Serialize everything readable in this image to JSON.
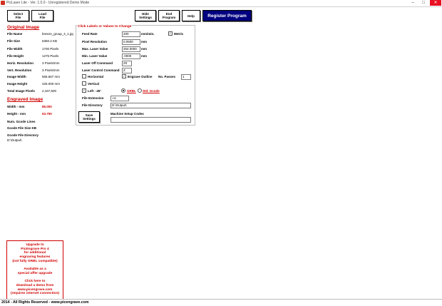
{
  "window": {
    "title": "PicLaser Lite - Ver. 1.0.0 - Unregistered Demo Mode",
    "min": "–",
    "max": "□",
    "close": "✕"
  },
  "toolbar": {
    "select_file": [
      "Select",
      "File"
    ],
    "load_file": [
      "Load",
      "File"
    ],
    "hide_settings": [
      "Hide",
      "Settings"
    ],
    "end_program": [
      "End",
      "Program"
    ],
    "help": "Help",
    "register": "Register Program"
  },
  "original_image": {
    "heading": "Original Image",
    "rows": [
      {
        "label": "File Name",
        "value": "breeze_group_4_1.jpg"
      },
      {
        "label": "File Size",
        "value": "6350.2  KB"
      },
      {
        "label": "File Width",
        "value": "1700  Pixels"
      },
      {
        "label": "File Height",
        "value": "1275  Pixels"
      },
      {
        "label": "Horiz. Resolution",
        "value": "3 Pixels/mm"
      },
      {
        "label": "Vert. Resolution",
        "value": "3 Pixels/mm"
      },
      {
        "label": "Image Width",
        "value": "566.667 mm"
      },
      {
        "label": "Image Height",
        "value": "425.000 mm"
      },
      {
        "label": "Total Image Pixels",
        "value": "2,167,500"
      }
    ]
  },
  "engraved_image": {
    "heading": "Engraved Image",
    "width_label": "Width - mm",
    "width_value": "85.000",
    "height_label": "Height - mm",
    "height_value": "63.750",
    "gcode_lines_label": "Num. Gcode Lines",
    "gcode_size_label": "Gcode File Size KB",
    "gcode_dir_label": "Gcode File Directory",
    "gcode_dir_value": "D:\\Output\\"
  },
  "settings": {
    "title": "Click Labels or Values to Change",
    "feed_rate_label": "Feed Rate",
    "feed_rate_value": "200",
    "feed_rate_unit": "mm/min.",
    "metric_label": "Metric",
    "pixel_res_label": "Pixel Resolution",
    "pixel_res_value": "0.0500",
    "pixel_res_unit": "mm",
    "max_laser_label": "Max. Laser Value",
    "max_laser_value": "254.0000",
    "max_laser_unit": "mm",
    "min_laser_label": "Min. Laser Value",
    "min_laser_value": ".0000",
    "min_laser_unit": "mm",
    "laser_off_label": "Laser Off Command",
    "laser_off_value": "Z0",
    "laser_ctrl_label": "Laser Control Command",
    "laser_ctrl_value": "Z",
    "horizontal_label": "Horizontal",
    "engrave_outline_label": "Engrave Outline",
    "no_passes_label": "No. Passes",
    "no_passes_value": "1",
    "vertical_label": "Vertical",
    "left45_label": "Left - 45°",
    "grbl_label": "GRBL",
    "std_gcode_label": "Std. Gcode",
    "file_ext_label": "File Extension",
    "file_ext_value": ".nc",
    "file_dir_label": "File Directory",
    "file_dir_value": "D:\\Output\\",
    "save_label": [
      "Save",
      "Settings"
    ],
    "machine_codes_label": "Machine Setup Codes",
    "machine_codes_value": ""
  },
  "upgrade": {
    "lines": [
      "Upgrade to",
      "PicEngrave Pro 4",
      "for additional",
      "engraving  features",
      "(not fully GRBL compatible)",
      "",
      "Available as a",
      "special offer upgrade",
      "",
      "Click here to",
      "download a demo from",
      "www.picengrave.com",
      "(requires internet connection)"
    ]
  },
  "footer": "2014 - All Rights Reserved - www.picengrave.com",
  "colors": {
    "accent_red": "#d00000",
    "register_bg": "#000080"
  }
}
